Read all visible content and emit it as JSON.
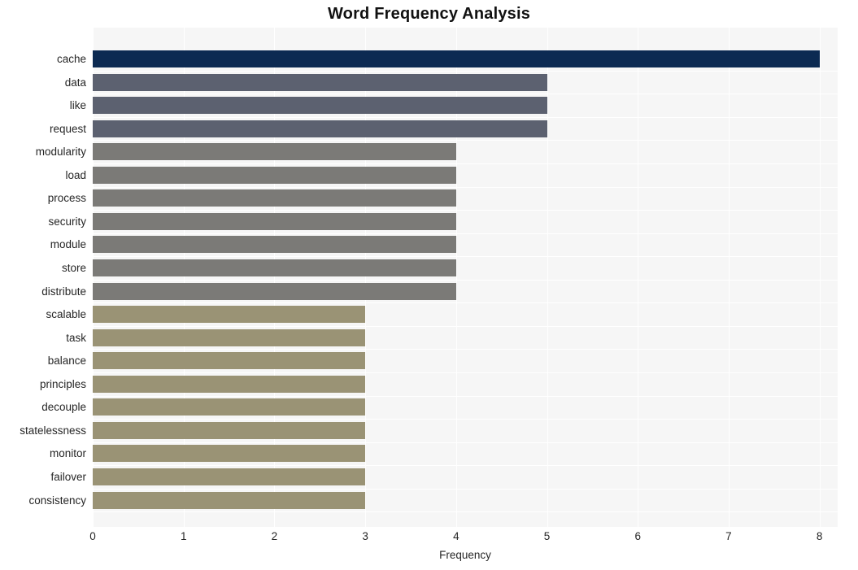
{
  "chart_data": {
    "type": "bar",
    "orientation": "horizontal",
    "title": "Word Frequency Analysis",
    "xlabel": "Frequency",
    "ylabel": "",
    "xlim": [
      0,
      8.2
    ],
    "xticks": [
      "0",
      "1",
      "2",
      "3",
      "4",
      "5",
      "6",
      "7",
      "8"
    ],
    "grid": true,
    "legend": false,
    "categories": [
      "cache",
      "data",
      "like",
      "request",
      "modularity",
      "load",
      "process",
      "security",
      "module",
      "store",
      "distribute",
      "scalable",
      "task",
      "balance",
      "principles",
      "decouple",
      "statelessness",
      "monitor",
      "failover",
      "consistency"
    ],
    "values": [
      8,
      5,
      5,
      5,
      4,
      4,
      4,
      4,
      4,
      4,
      4,
      3,
      3,
      3,
      3,
      3,
      3,
      3,
      3,
      3
    ],
    "bar_colors": [
      "#0c2a52",
      "#5c6170",
      "#5c6170",
      "#5c6170",
      "#7b7a77",
      "#7b7a77",
      "#7b7a77",
      "#7b7a77",
      "#7b7a77",
      "#7b7a77",
      "#7b7a77",
      "#9a9375",
      "#9a9375",
      "#9a9375",
      "#9a9375",
      "#9a9375",
      "#9a9375",
      "#9a9375",
      "#9a9375",
      "#9a9375"
    ]
  },
  "style": {
    "plot_background": "#f6f6f6",
    "grid_color": "#ffffff",
    "figure_background": "#ffffff",
    "text_color": "#262626"
  }
}
